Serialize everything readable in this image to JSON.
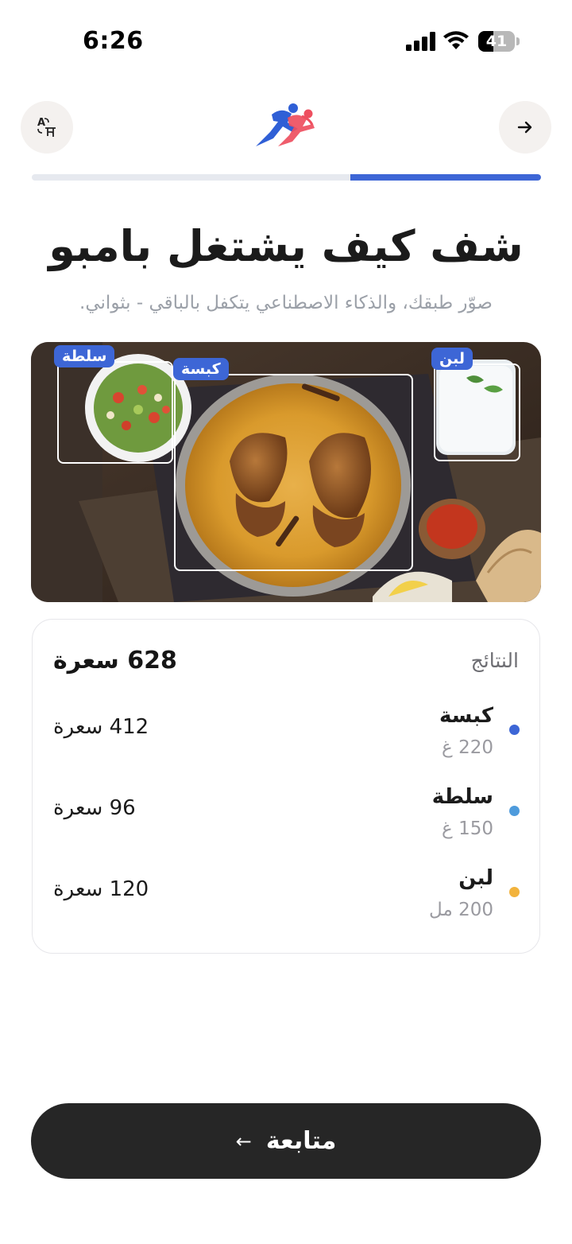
{
  "status_bar": {
    "time": "6:26",
    "battery_level": "41",
    "battery_fraction": 0.41
  },
  "header": {
    "language_button_icon": "translate-icon",
    "logo_icon": "runners-logo-icon",
    "next_button_icon": "arrow-right-icon"
  },
  "progress": {
    "fraction": 0.375,
    "accent_color": "#3d66d6"
  },
  "page": {
    "title": "شف كيف يشتغل بامبو",
    "subtitle": "صوّر طبقك، والذكاء الاصطناعي يتكفل بالباقي - بثواني."
  },
  "photo": {
    "detections": [
      {
        "label": "سلطة"
      },
      {
        "label": "كبسة"
      },
      {
        "label": "لبن"
      }
    ]
  },
  "results": {
    "label": "النتائج",
    "total": "628 سعرة",
    "items": [
      {
        "name": "كبسة",
        "amount": "220 غ",
        "calories": "412 سعرة",
        "dot_color": "#3d66d6"
      },
      {
        "name": "سلطة",
        "amount": "150 غ",
        "calories": "96 سعرة",
        "dot_color": "#4e9bdc"
      },
      {
        "name": "لبن",
        "amount": "200 مل",
        "calories": "120 سعرة",
        "dot_color": "#f2b33d"
      }
    ]
  },
  "footer": {
    "continue_label": "متابعة",
    "continue_icon": "arrow-left-icon"
  }
}
